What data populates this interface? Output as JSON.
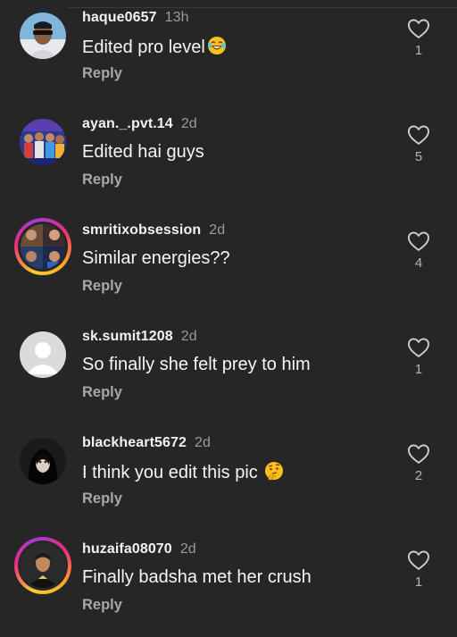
{
  "comments": [
    {
      "username": "haque0657",
      "time": "13h",
      "text": "Edited pro level",
      "emoji": "laughing-emoji",
      "reply": "Reply",
      "likes": "1"
    },
    {
      "username": "ayan._.pvt.14",
      "time": "2d",
      "text": "Edited hai guys",
      "reply": "Reply",
      "likes": "5"
    },
    {
      "username": "smritixobsession",
      "time": "2d",
      "text": "Similar energies??",
      "reply": "Reply",
      "likes": "4"
    },
    {
      "username": "sk.sumit1208",
      "time": "2d",
      "text": "So finally she felt prey to him",
      "reply": "Reply",
      "likes": "1"
    },
    {
      "username": "blackheart5672",
      "time": "2d",
      "text": "I think you edit this pic ",
      "emoji": "thinking-emoji",
      "reply": "Reply",
      "likes": "2"
    },
    {
      "username": "huzaifa08070",
      "time": "2d",
      "text": "Finally badsha met her crush",
      "reply": "Reply",
      "likes": "1"
    }
  ],
  "colors": {
    "background": "#262626",
    "primary_text": "#f5f5f5",
    "secondary_text": "#a8a8a8",
    "story_ring": "#ee2a7b"
  }
}
